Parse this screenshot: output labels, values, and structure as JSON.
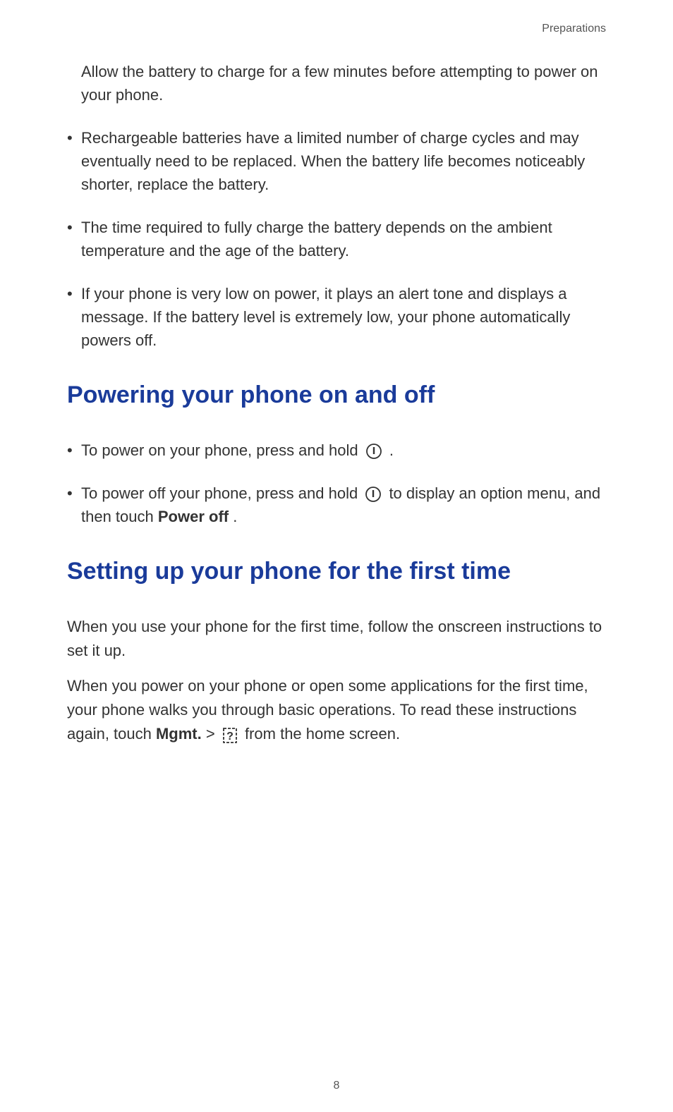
{
  "header": {
    "section_label": "Preparations"
  },
  "intro": {
    "text": "Allow the battery to charge for a few minutes before attempting to power on your phone."
  },
  "bullets": {
    "b1": "Rechargeable batteries have a limited number of charge cycles and may eventually need to be replaced. When the battery life becomes noticeably shorter, replace the battery.",
    "b2": "The time required to fully charge the battery depends on the ambient temperature and the age of the battery.",
    "b3": "If your phone is very low on power, it plays an alert tone and displays a message. If the battery level is extremely low, your phone automatically powers off."
  },
  "section1": {
    "heading": "Powering your phone on and off",
    "item1_pre": "To power on your phone, press and hold ",
    "item1_post": " .",
    "item2_pre": "To power off your phone, press and hold ",
    "item2_mid": " to display an option menu, and then touch ",
    "item2_bold": "Power off",
    "item2_post": "."
  },
  "section2": {
    "heading": "Setting up your phone for the first time",
    "p1": "When you use your phone for the first time, follow the onscreen instructions to set it up.",
    "p2_pre": "When you power on your phone or open some applications for the first time, your phone walks you through basic operations. To read these instructions again, touch ",
    "p2_bold": "Mgmt.",
    "p2_mid": " > ",
    "p2_post": " from the home screen."
  },
  "footer": {
    "page_number": "8"
  }
}
